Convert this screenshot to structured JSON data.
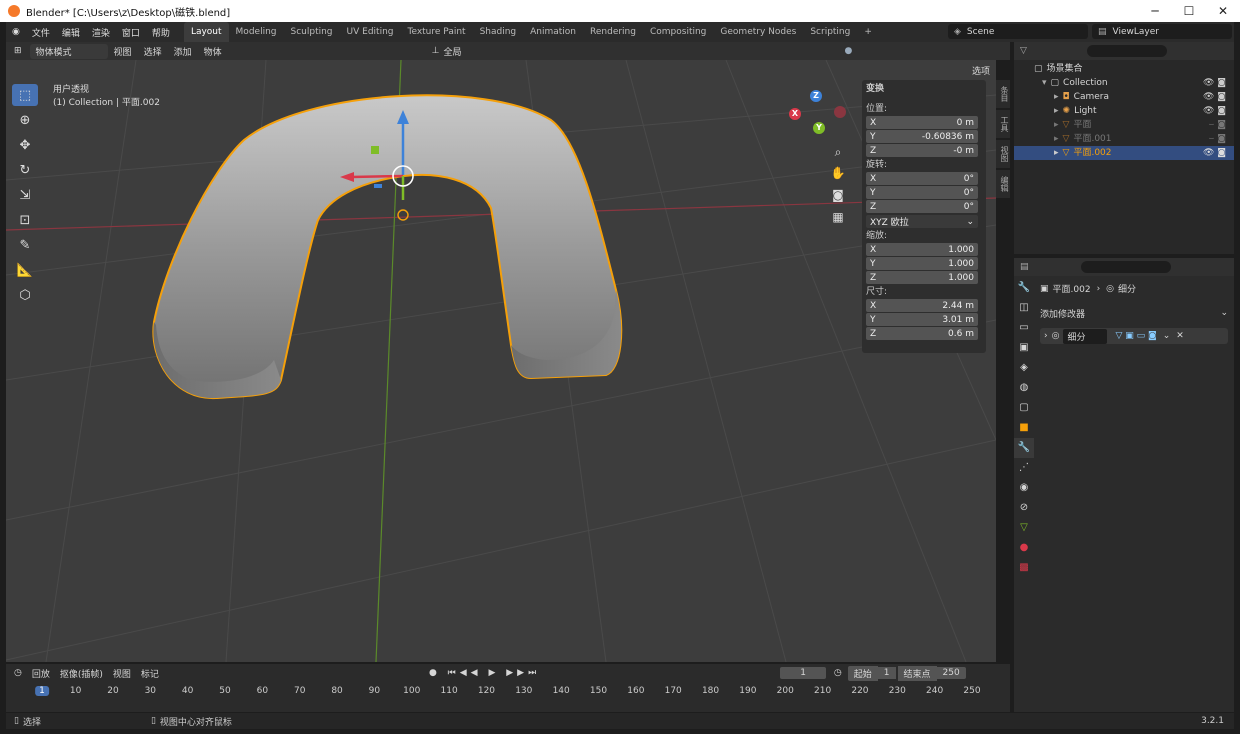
{
  "window": {
    "title": "Blender* [C:\\Users\\z\\Desktop\\磁铁.blend]",
    "min": "─",
    "max": "☐",
    "close": "✕"
  },
  "menu": [
    "文件",
    "编辑",
    "渲染",
    "窗口",
    "帮助"
  ],
  "workspaces": [
    "Layout",
    "Modeling",
    "Sculpting",
    "UV Editing",
    "Texture Paint",
    "Shading",
    "Animation",
    "Rendering",
    "Compositing",
    "Geometry Nodes",
    "Scripting"
  ],
  "workspace_add": "+",
  "scene": "Scene",
  "view_layer": "ViewLayer",
  "header3d": {
    "mode": "物体模式",
    "menus": [
      "视图",
      "选择",
      "添加",
      "物体"
    ],
    "transform_orient": "全局",
    "options": "选项"
  },
  "viewport": {
    "view_name": "用户透视",
    "collection_info": "(1) Collection | 平面.002"
  },
  "gizmo": {
    "z": "Z",
    "y": "Y",
    "x": "X"
  },
  "npanel": {
    "title": "变换",
    "loc_label": "位置:",
    "loc": [
      {
        "a": "X",
        "v": "0 m"
      },
      {
        "a": "Y",
        "v": "-0.60836 m"
      },
      {
        "a": "Z",
        "v": "-0 m"
      }
    ],
    "rot_label": "旋转:",
    "rot": [
      {
        "a": "X",
        "v": "0°"
      },
      {
        "a": "Y",
        "v": "0°"
      },
      {
        "a": "Z",
        "v": "0°"
      }
    ],
    "rot_mode": "XYZ 欧拉",
    "scale_label": "缩放:",
    "scale": [
      {
        "a": "X",
        "v": "1.000"
      },
      {
        "a": "Y",
        "v": "1.000"
      },
      {
        "a": "Z",
        "v": "1.000"
      }
    ],
    "dim_label": "尺寸:",
    "dim": [
      {
        "a": "X",
        "v": "2.44 m"
      },
      {
        "a": "Y",
        "v": "3.01 m"
      },
      {
        "a": "Z",
        "v": "0.6 m"
      }
    ]
  },
  "side_tabs": [
    "条目",
    "工具",
    "视图",
    "编辑"
  ],
  "outliner": {
    "root": "场景集合",
    "items": [
      {
        "name": "Collection",
        "indent": 0
      },
      {
        "name": "Camera",
        "indent": 1
      },
      {
        "name": "Light",
        "indent": 1
      },
      {
        "name": "平面",
        "indent": 1
      },
      {
        "name": "平面.001",
        "indent": 1
      },
      {
        "name": "平面.002",
        "indent": 1
      }
    ]
  },
  "properties": {
    "object": "平面.002",
    "modifier_tab": "细分",
    "add_modifier": "添加修改器",
    "modifier_name": "细分"
  },
  "timeline": {
    "menus": [
      "回放",
      "抠像(插帧)",
      "视图",
      "标记"
    ],
    "current": "1",
    "start_label": "起始",
    "start": "1",
    "end_label": "结束点",
    "end": "250",
    "ticks": [
      "1",
      "10",
      "20",
      "30",
      "40",
      "50",
      "60",
      "70",
      "80",
      "90",
      "100",
      "110",
      "120",
      "130",
      "140",
      "150",
      "160",
      "170",
      "180",
      "190",
      "200",
      "210",
      "220",
      "230",
      "240",
      "250"
    ]
  },
  "status": {
    "select": "选择",
    "center": "视图中心对齐鼠标",
    "version": "3.2.1"
  },
  "colors": {
    "accent": "#4772b3",
    "selection": "#f5a00a",
    "x_axis": "#d9394a",
    "y_axis": "#7fbd27",
    "z_axis": "#3d82d9"
  }
}
